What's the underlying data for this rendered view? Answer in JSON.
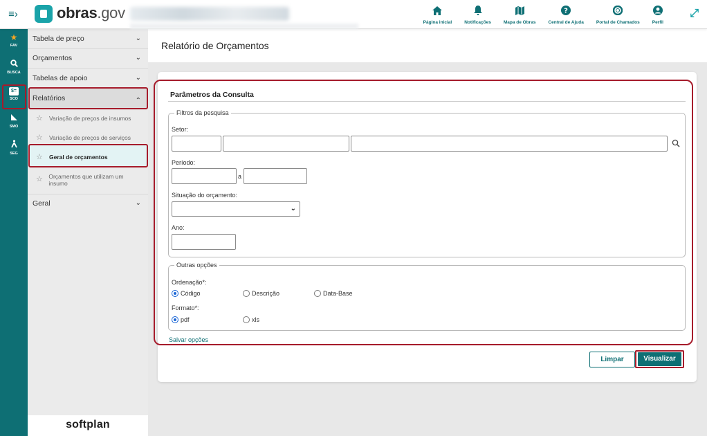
{
  "app": {
    "logo_brand": "obras",
    "logo_suffix": ".gov",
    "footer_brand": "softplan"
  },
  "topnav": [
    {
      "label": "Página inicial",
      "icon": "home-icon"
    },
    {
      "label": "Notificações",
      "icon": "bell-icon"
    },
    {
      "label": "Mapa de Obras",
      "icon": "map-icon"
    },
    {
      "label": "Central de Ajuda",
      "icon": "help-icon"
    },
    {
      "label": "Portal de Chamados",
      "icon": "lifebuoy-icon"
    },
    {
      "label": "Perfil",
      "icon": "user-icon"
    }
  ],
  "strip": [
    {
      "label": "FAV",
      "icon": "star-icon"
    },
    {
      "label": "BUSCA",
      "icon": "search-icon"
    },
    {
      "label": "SCO",
      "icon": "sco-icon"
    },
    {
      "label": "SMO",
      "icon": "ruler-icon"
    },
    {
      "label": "SEG",
      "icon": "worker-icon"
    }
  ],
  "sidebar": {
    "items": [
      {
        "label": "Tabela de preço"
      },
      {
        "label": "Orçamentos"
      },
      {
        "label": "Tabelas de apoio"
      },
      {
        "label": "Relatórios"
      },
      {
        "label": "Geral"
      }
    ],
    "sub_items": [
      {
        "label": "Variação de preços de insumos"
      },
      {
        "label": "Variação de preços de serviços"
      },
      {
        "label": "Geral de orçamentos"
      },
      {
        "label": "Orçamentos que utilizam um insumo"
      }
    ]
  },
  "page": {
    "title": "Relatório de Orçamentos",
    "section_title": "Parâmetros da Consulta"
  },
  "filters": {
    "legend": "Filtros da pesquisa",
    "setor_label": "Setor:",
    "periodo_label": "Período:",
    "periodo_separator": "a",
    "situacao_label": "Situação do orçamento:",
    "situacao_value": "",
    "ano_label": "Ano:"
  },
  "options": {
    "legend": "Outras opções",
    "ordenacao_label": "Ordenação*:",
    "ordenacao_options": [
      "Código",
      "Descrição",
      "Data-Base"
    ],
    "ordenacao_selected": "Código",
    "formato_label": "Formato*:",
    "formato_options": [
      "pdf",
      "xls"
    ],
    "formato_selected": "pdf"
  },
  "actions": {
    "salvar_label": "Salvar opções",
    "limpar_label": "Limpar",
    "visualizar_label": "Visualizar"
  },
  "colors": {
    "brand_teal": "#0e6f74",
    "highlight_red": "#a61b2b"
  }
}
